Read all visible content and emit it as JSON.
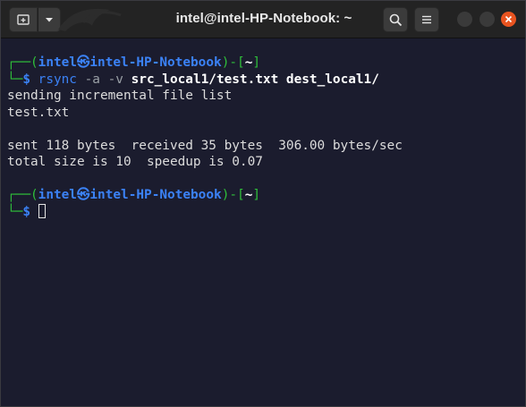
{
  "window": {
    "title": "intel@intel-HP-Notebook: ~"
  },
  "icons": {
    "new_tab": "new-tab-icon",
    "menu": "chevron-down-icon",
    "search": "search-icon",
    "hamburger": "hamburger-menu-icon",
    "minimize": "minimize-icon",
    "maximize": "maximize-icon",
    "close": "close-icon",
    "skull": "kali-skull-icon"
  },
  "colors": {
    "terminal_bg": "#1b1c2e",
    "prompt_green": "#2fbf3a",
    "prompt_blue": "#3b82f6",
    "close_button": "#e95420"
  },
  "terminal": {
    "prompt1": {
      "corner_top": "┌──(",
      "user": "intel",
      "host": "intel-HP-Notebook",
      "mid": ")-[",
      "dir": "~",
      "end": "]",
      "corner_bottom": "└─",
      "dollar": "$ ",
      "command": "rsync",
      "flags": " -a -v ",
      "args": "src_local1/test.txt dest_local1/"
    },
    "output": [
      "sending incremental file list",
      "test.txt",
      "",
      "sent 118 bytes  received 35 bytes  306.00 bytes/sec",
      "total size is 10  speedup is 0.07"
    ],
    "prompt2": {
      "corner_top": "┌──(",
      "user": "intel",
      "host": "intel-HP-Notebook",
      "mid": ")-[",
      "dir": "~",
      "end": "]",
      "corner_bottom": "└─",
      "dollar": "$ "
    }
  }
}
